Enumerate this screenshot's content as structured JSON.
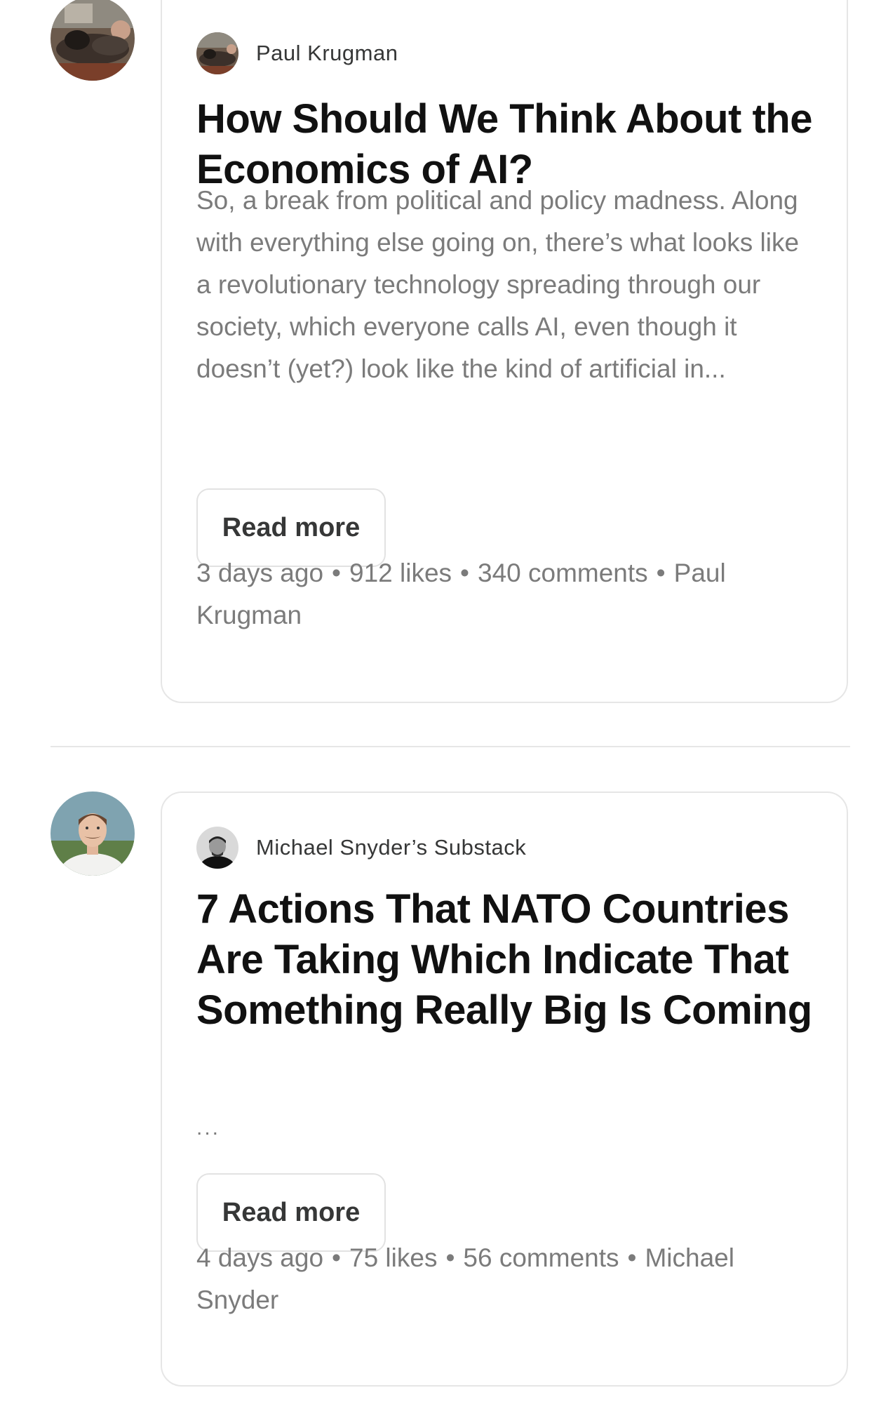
{
  "feed": {
    "posts": [
      {
        "author_avatar_icon": "user-photo-icon",
        "publication_name": "Paul Krugman",
        "publication_logo_icon": "publication-logo-icon",
        "title": "How Should We Think About the Economics of AI?",
        "excerpt": "So, a break from political and policy madness. Along with everything else going on, there’s what looks like a revolutionary technology spreading through our society, which everyone calls AI, even though it doesn’t (yet?) look like the kind of artificial in...",
        "read_more_label": "Read more",
        "meta": {
          "age": "3 days ago",
          "likes": "912 likes",
          "comments": "340 comments",
          "author": "Paul Krugman",
          "separator": "•"
        }
      },
      {
        "author_avatar_icon": "user-photo-icon",
        "publication_name": "Michael Snyder’s Substack",
        "publication_logo_icon": "publication-logo-icon",
        "title": "7 Actions That NATO Countries Are Taking Which Indicate That Something Really Big Is Coming",
        "excerpt": "...",
        "read_more_label": "Read more",
        "meta": {
          "age": "4 days ago",
          "likes": "75 likes",
          "comments": "56 comments",
          "author": "Michael Snyder",
          "separator": "•"
        }
      }
    ]
  },
  "colors": {
    "title": "#111111",
    "secondary_text": "#7b7b7b",
    "publication_text": "#363737",
    "border": "#e6e6e6",
    "background": "#ffffff"
  }
}
